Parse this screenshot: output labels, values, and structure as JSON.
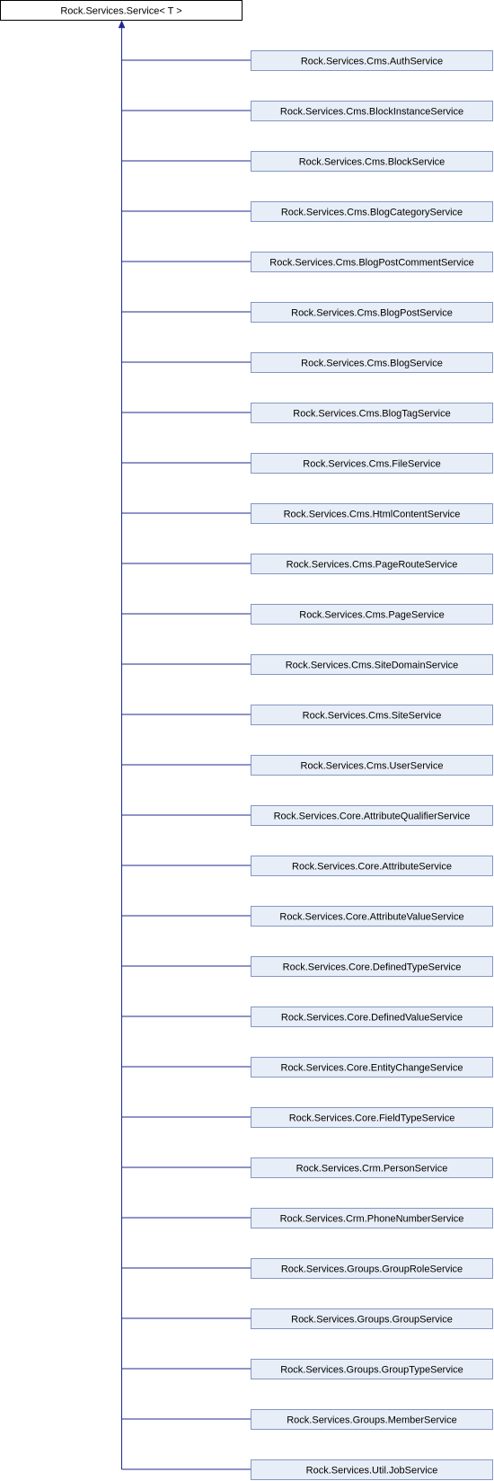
{
  "diagram": {
    "base_class": "Rock.Services.Service< T >",
    "derived_classes": [
      "Rock.Services.Cms.AuthService",
      "Rock.Services.Cms.BlockInstanceService",
      "Rock.Services.Cms.BlockService",
      "Rock.Services.Cms.BlogCategoryService",
      "Rock.Services.Cms.BlogPostCommentService",
      "Rock.Services.Cms.BlogPostService",
      "Rock.Services.Cms.BlogService",
      "Rock.Services.Cms.BlogTagService",
      "Rock.Services.Cms.FileService",
      "Rock.Services.Cms.HtmlContentService",
      "Rock.Services.Cms.PageRouteService",
      "Rock.Services.Cms.PageService",
      "Rock.Services.Cms.SiteDomainService",
      "Rock.Services.Cms.SiteService",
      "Rock.Services.Cms.UserService",
      "Rock.Services.Core.AttributeQualifierService",
      "Rock.Services.Core.AttributeService",
      "Rock.Services.Core.AttributeValueService",
      "Rock.Services.Core.DefinedTypeService",
      "Rock.Services.Core.DefinedValueService",
      "Rock.Services.Core.EntityChangeService",
      "Rock.Services.Core.FieldTypeService",
      "Rock.Services.Crm.PersonService",
      "Rock.Services.Crm.PhoneNumberService",
      "Rock.Services.Groups.GroupRoleService",
      "Rock.Services.Groups.GroupService",
      "Rock.Services.Groups.GroupTypeService",
      "Rock.Services.Groups.MemberService",
      "Rock.Services.Util.JobService"
    ],
    "colors": {
      "base_fill": "#ffffff",
      "base_border": "#000000",
      "node_fill": "#e8eef7",
      "node_border": "#8497c4",
      "connector": "#1f2a8f"
    }
  }
}
